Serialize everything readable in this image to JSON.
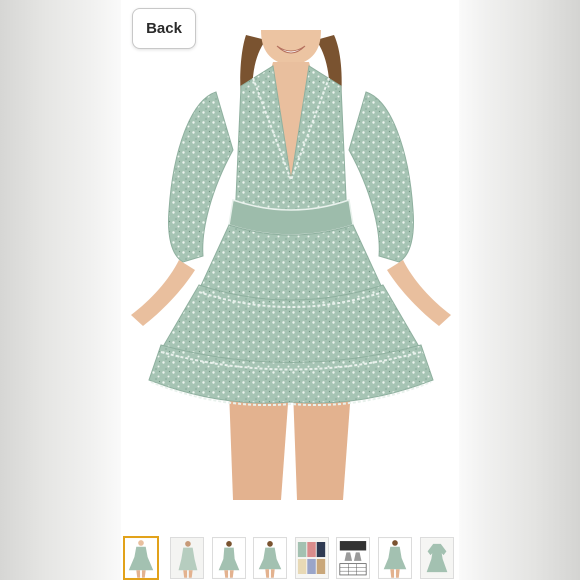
{
  "viewer": {
    "back_label": "Back",
    "main_image": {
      "icon": "green-floral-ruffle-dress-photo"
    },
    "thumbnails": [
      {
        "icon": "dress-front-thumbnail",
        "selected": true
      },
      {
        "icon": "dress-side-thumbnail",
        "selected": false
      },
      {
        "icon": "dress-front-alt-thumbnail",
        "selected": false
      },
      {
        "icon": "dress-pose-thumbnail",
        "selected": false
      },
      {
        "icon": "color-options-thumbnail",
        "selected": false
      },
      {
        "icon": "size-chart-thumbnail",
        "selected": false
      },
      {
        "icon": "dress-back-thumbnail",
        "selected": false
      },
      {
        "icon": "dress-flat-thumbnail",
        "selected": false
      }
    ]
  },
  "colors": {
    "dress": "#a3c1b1",
    "dress_dark": "#7fa391",
    "skin": "#e9bf9e",
    "hair": "#7a5330",
    "selected_border": "#e2a21a"
  }
}
